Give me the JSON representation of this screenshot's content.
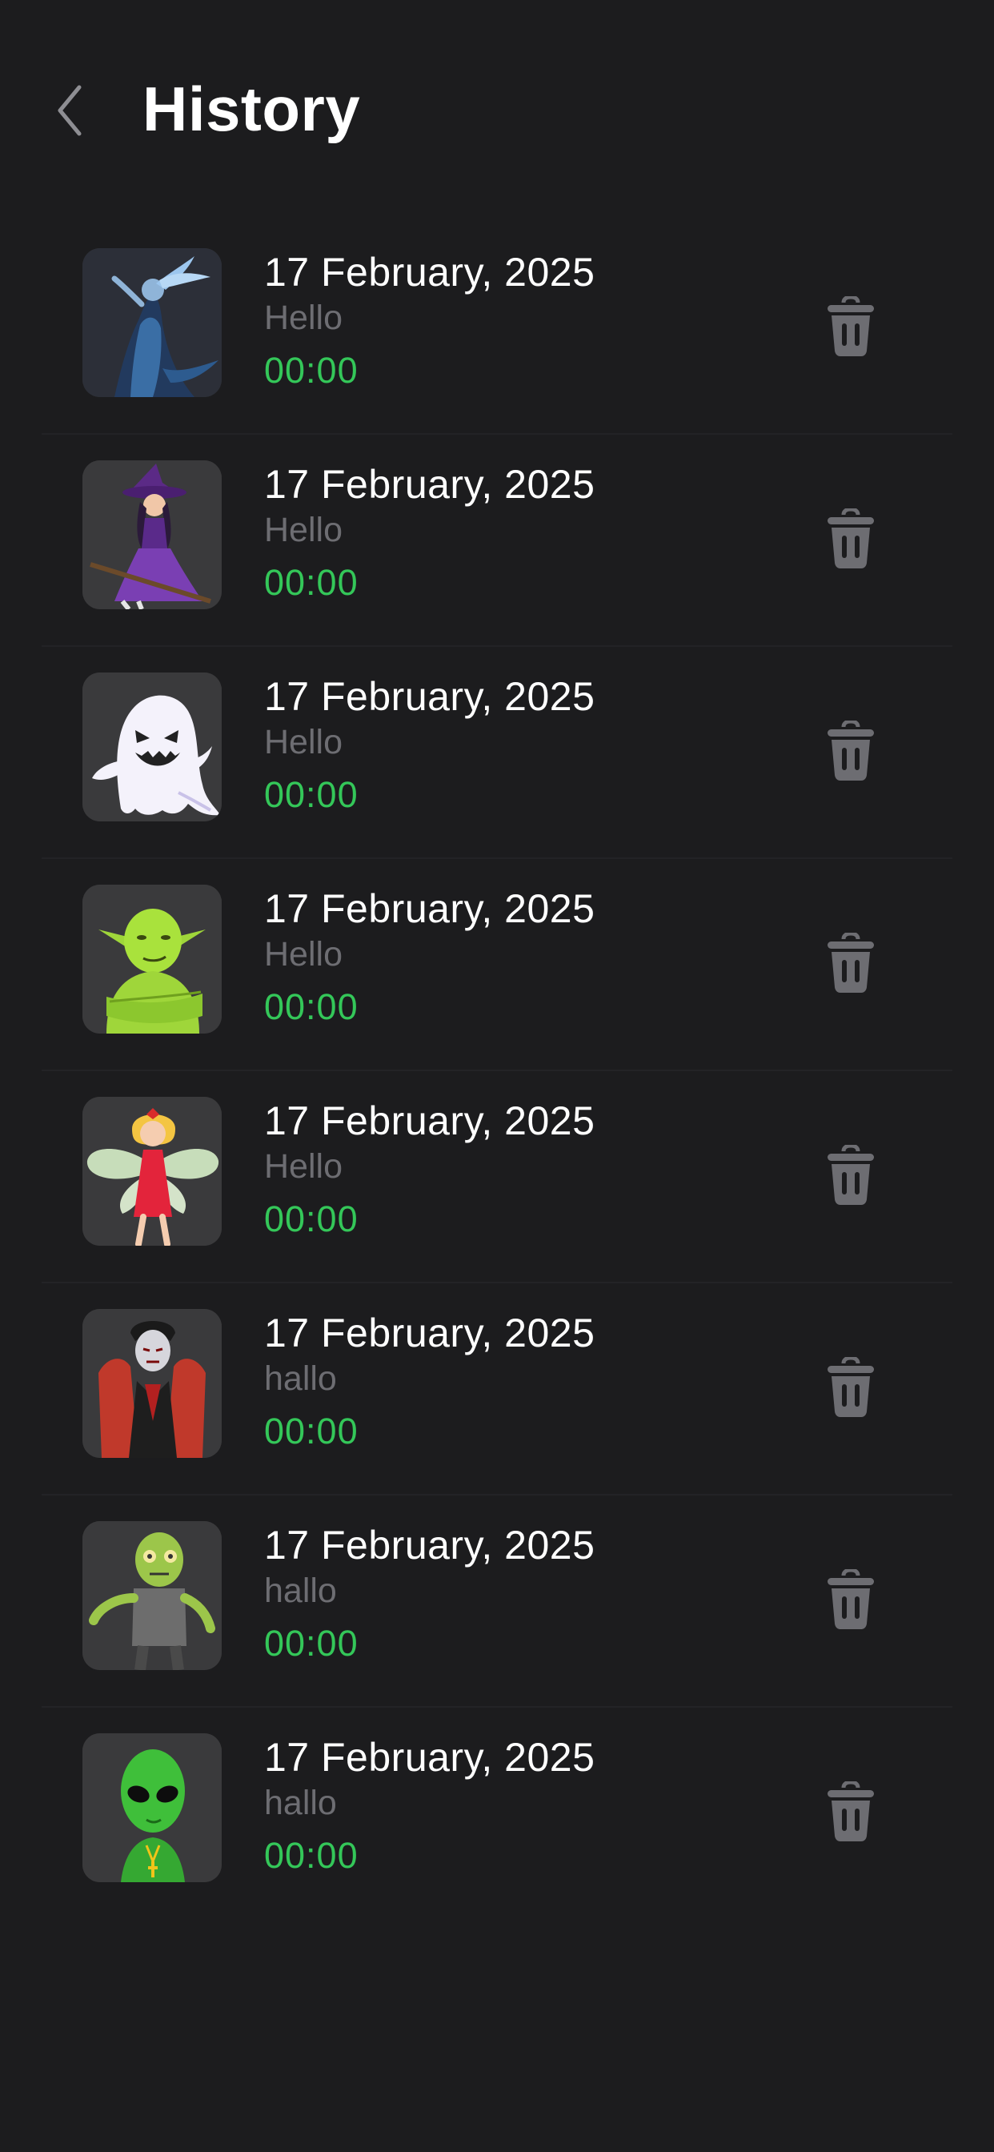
{
  "header": {
    "title": "History",
    "back_icon": "chevron-left-icon"
  },
  "colors": {
    "background": "#1c1c1e",
    "thumb_background": "#3a3a3c",
    "date_text": "#ffffff",
    "message_text": "#6d6d72",
    "duration_text": "#34c759",
    "trash_icon": "#6d6d72"
  },
  "history": [
    {
      "character": "ice-spirit",
      "date": "17 February, 2025",
      "message": "Hello",
      "duration": "00:00",
      "icon": "trash-icon"
    },
    {
      "character": "witch",
      "date": "17 February, 2025",
      "message": "Hello",
      "duration": "00:00",
      "icon": "trash-icon"
    },
    {
      "character": "ghost",
      "date": "17 February, 2025",
      "message": "Hello",
      "duration": "00:00",
      "icon": "trash-icon"
    },
    {
      "character": "goblin",
      "date": "17 February, 2025",
      "message": "Hello",
      "duration": "00:00",
      "icon": "trash-icon"
    },
    {
      "character": "fairy",
      "date": "17 February, 2025",
      "message": "Hello",
      "duration": "00:00",
      "icon": "trash-icon"
    },
    {
      "character": "vampire",
      "date": "17 February, 2025",
      "message": "hallo",
      "duration": "00:00",
      "icon": "trash-icon"
    },
    {
      "character": "zombie",
      "date": "17 February, 2025",
      "message": "hallo",
      "duration": "00:00",
      "icon": "trash-icon"
    },
    {
      "character": "alien",
      "date": "17 February, 2025",
      "message": "hallo",
      "duration": "00:00",
      "icon": "trash-icon"
    }
  ]
}
